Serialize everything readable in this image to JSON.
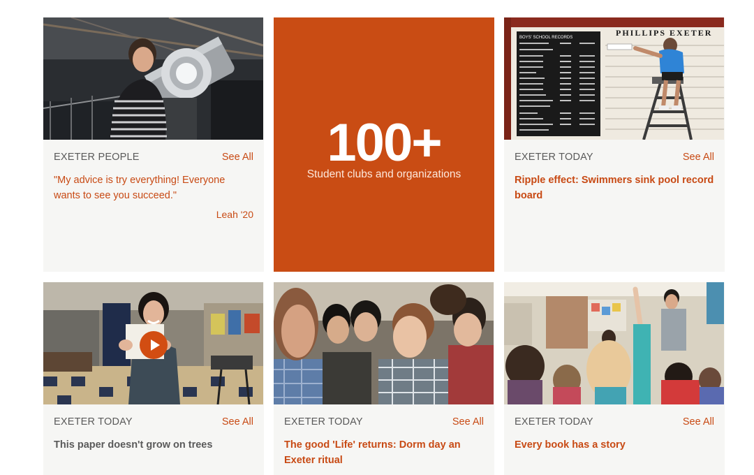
{
  "cards": [
    {
      "category": "EXETER PEOPLE",
      "see_all": "See All",
      "quote": "\"My advice is try everything! Everyone wants to see you succeed.\"",
      "author": "Leah '20",
      "photo": "student-with-telescope"
    },
    {
      "category": "EXETER TODAY",
      "see_all": "See All",
      "title": "Ripple effect: Swimmers sink pool record board",
      "photo": "pool-record-board",
      "board": {
        "header": "PHILLIPS   EXETER",
        "subheader": "BOYS' SCHOOL RECORDS"
      }
    },
    {
      "category": "EXETER TODAY",
      "see_all": "See All",
      "title": "This paper doesn't grow on trees",
      "photo": "paper-workshop-video",
      "media_icon": "play-icon"
    },
    {
      "category": "EXETER TODAY",
      "see_all": "See All",
      "title": "The good 'Life' returns: Dorm day an Exeter ritual",
      "photo": "students-huddle"
    },
    {
      "category": "EXETER TODAY",
      "see_all": "See All",
      "title": "Every book has a story",
      "photo": "classroom-raised-hands"
    }
  ],
  "stat": {
    "number": "100+",
    "label": "Student clubs and organizations"
  },
  "colors": {
    "accent": "#c84a14",
    "stat_bg": "#c94c14",
    "card_bg": "#f6f6f4",
    "muted_text": "#5a5a5a"
  }
}
